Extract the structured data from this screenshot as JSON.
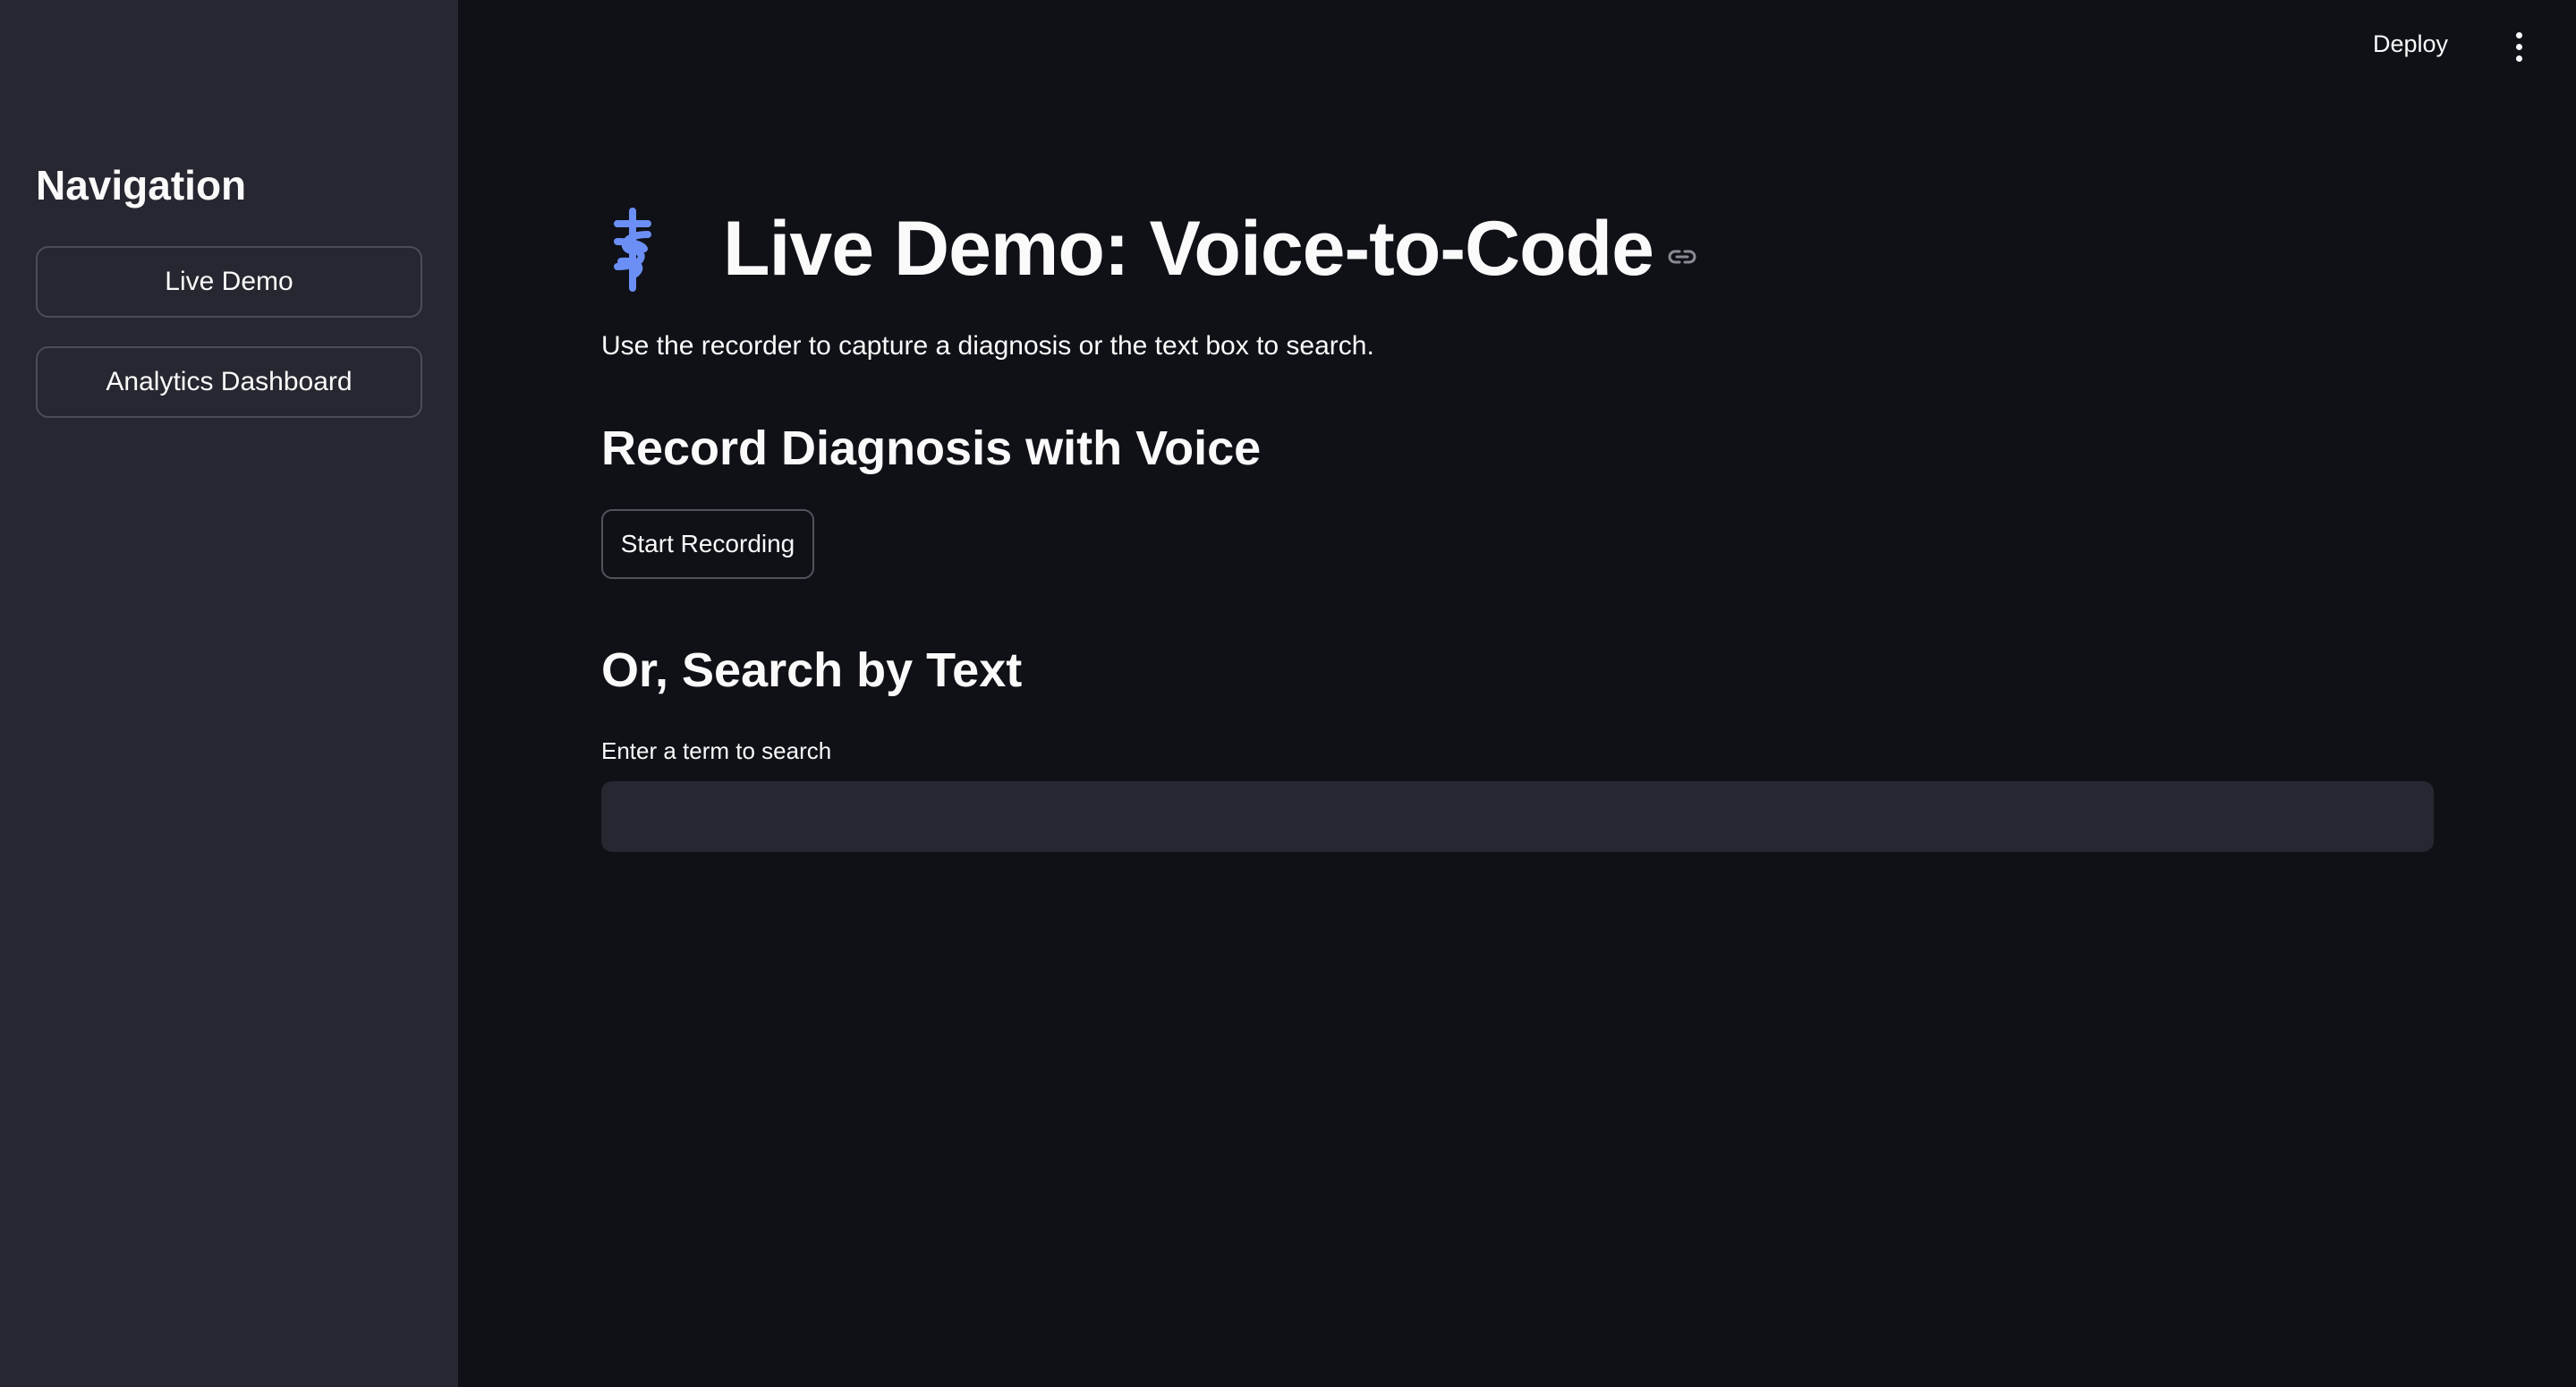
{
  "sidebar": {
    "title": "Navigation",
    "items": [
      {
        "label": "Live Demo"
      },
      {
        "label": "Analytics Dashboard"
      }
    ]
  },
  "header": {
    "deploy_label": "Deploy",
    "menu_icon": "vertical-ellipsis-icon"
  },
  "main": {
    "title_icon": "medical-caduceus-icon",
    "title": "Live Demo: Voice-to-Code",
    "title_link_icon": "link-icon",
    "intro": "Use the recorder to capture a diagnosis or the text box to search.",
    "record_section": {
      "heading": "Record Diagnosis with Voice",
      "button_label": "Start Recording"
    },
    "search_section": {
      "heading": "Or, Search by Text",
      "input_label": "Enter a term to search",
      "input_value": "",
      "input_placeholder": ""
    }
  },
  "colors": {
    "background": "#0f1117",
    "sidebar": "#262730",
    "text": "#fafafa",
    "icon_accent": "#6b8ff5"
  }
}
